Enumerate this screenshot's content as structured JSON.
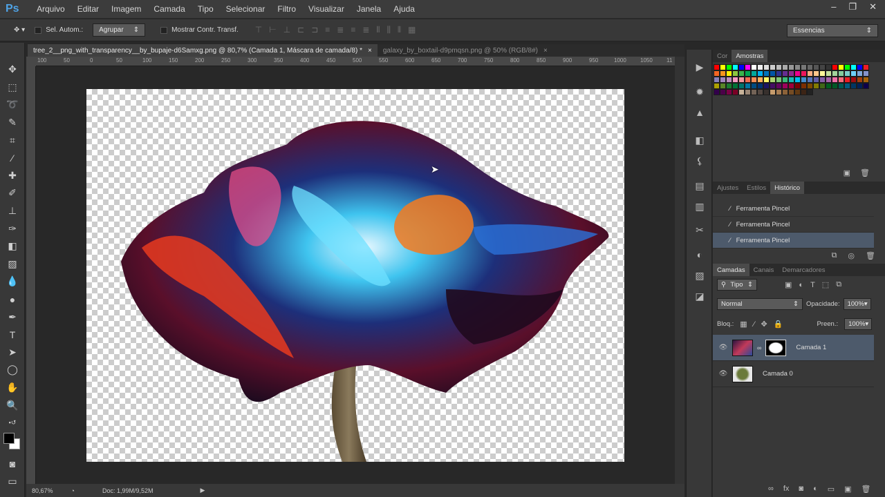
{
  "app": {
    "logo": "Ps"
  },
  "menu": [
    "Arquivo",
    "Editar",
    "Imagem",
    "Camada",
    "Tipo",
    "Selecionar",
    "Filtro",
    "Visualizar",
    "Janela",
    "Ajuda"
  ],
  "window_controls": {
    "minimize": "–",
    "restore": "❐",
    "close": "✕"
  },
  "options": {
    "auto_select_label": "Sel. Autom.:",
    "group_value": "Agrupar",
    "show_transform_label": "Mostrar Contr. Transf.",
    "workspace": "Essencias"
  },
  "tabs": [
    {
      "label": "tree_2__png_with_transparency__by_bupaje-d6Samxg.png @ 80,7% (Camada 1, Máscara de camada/8) *",
      "close": "×"
    },
    {
      "label": "galaxy_by_boxtail-d9pmqsn.png @ 50% (RGB/8#)",
      "close": "×"
    }
  ],
  "ruler_labels": [
    "100",
    "50",
    "0",
    "50",
    "100",
    "150",
    "200",
    "250",
    "300",
    "350",
    "400",
    "450",
    "500",
    "550",
    "600",
    "650",
    "700",
    "750",
    "800",
    "850",
    "900",
    "950",
    "1000",
    "1050",
    "11"
  ],
  "status": {
    "zoom": "80,67%",
    "doc": "Doc: 1,99M/9,52M",
    "arrow": "▶"
  },
  "swatches_panel": {
    "tabs": [
      "Cor",
      "Amostras"
    ],
    "active": 1
  },
  "swatch_colors": [
    "#ff0000",
    "#ffff00",
    "#00ff00",
    "#00ffff",
    "#0000ff",
    "#ff00ff",
    "#ffffff",
    "#eeeeee",
    "#dddddd",
    "#cccccc",
    "#bbbbbb",
    "#aaaaaa",
    "#999999",
    "#888888",
    "#777777",
    "#666666",
    "#555555",
    "#444444",
    "#333333",
    "#ff0000",
    "#ffff00",
    "#00ff00",
    "#00ffff",
    "#0000ff",
    "#ed1c24",
    "#f26522",
    "#f7941d",
    "#fff200",
    "#8dc63f",
    "#39b54a",
    "#00a651",
    "#00a99d",
    "#00aeef",
    "#0072bc",
    "#0054a6",
    "#2e3192",
    "#662d91",
    "#92278f",
    "#ec008c",
    "#ed145b",
    "#f9ad81",
    "#fdc68a",
    "#fff799",
    "#c4df9b",
    "#a2d39c",
    "#82ca9c",
    "#7accc8",
    "#6dcff6",
    "#7da7d9",
    "#8393ca",
    "#8781bd",
    "#a186be",
    "#bd8cbf",
    "#f49ac1",
    "#f5989d",
    "#f26c4f",
    "#f68e56",
    "#fbaf5d",
    "#fff568",
    "#acd373",
    "#7cc576",
    "#3bb878",
    "#1abbb4",
    "#00bff3",
    "#438ccb",
    "#5574b9",
    "#605ca8",
    "#855fa8",
    "#a763a8",
    "#f06ea9",
    "#f26d7d",
    "#ed1c24",
    "#9e0b0f",
    "#a0410d",
    "#a3620a",
    "#aba000",
    "#598527",
    "#1a7b30",
    "#007236",
    "#00746b",
    "#0076a3",
    "#004b80",
    "#003471",
    "#1b1464",
    "#440e62",
    "#630460",
    "#9e005d",
    "#9e0039",
    "#790000",
    "#7b2e00",
    "#7d4900",
    "#827b00",
    "#406618",
    "#005e20",
    "#005826",
    "#005952",
    "#005b7f",
    "#003663",
    "#002157",
    "#0d004c",
    "#32004b",
    "#4b0049",
    "#7b0046",
    "#7a0026",
    "#c7b299",
    "#998675",
    "#736357",
    "#534741",
    "#37302d",
    "#c69c6d",
    "#a67c52",
    "#8c6239",
    "#754c24",
    "#603913",
    "#3c2415",
    "#222222"
  ],
  "history_panel": {
    "tabs": [
      "Ajustes",
      "Estilos",
      "Histórico"
    ],
    "active": 2,
    "items": [
      "Ferramenta Pincel",
      "Ferramenta Pincel",
      "Ferramenta Pincel"
    ]
  },
  "layers_panel": {
    "tabs": [
      "Camadas",
      "Canais",
      "Demarcadores"
    ],
    "active": 0,
    "filter": "Tipo",
    "blend_mode": "Normal",
    "opacity_label": "Opacidade:",
    "opacity_value": "100%",
    "lock_label": "Bloq.:",
    "fill_label": "Preen.:",
    "fill_value": "100%",
    "layers": [
      {
        "name": "Camada 1",
        "selected": true,
        "has_mask": true
      },
      {
        "name": "Camada 0",
        "selected": false,
        "has_mask": false
      }
    ]
  }
}
